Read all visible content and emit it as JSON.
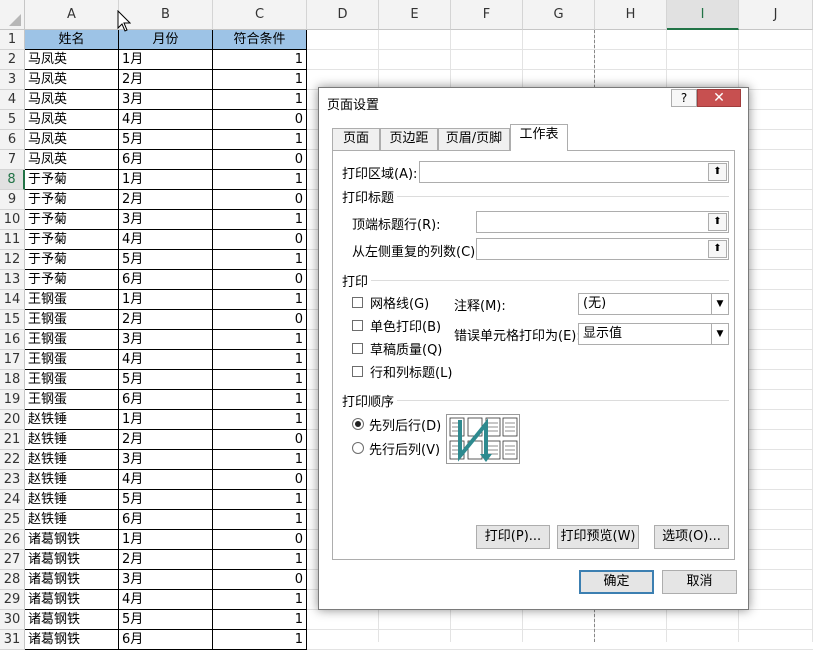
{
  "sheet": {
    "columns": [
      "A",
      "B",
      "C",
      "D",
      "E",
      "F",
      "G",
      "H",
      "I",
      "J"
    ],
    "selected_column": "I",
    "selected_row": 8,
    "rows": [
      1,
      2,
      3,
      4,
      5,
      6,
      7,
      8,
      9,
      10,
      11,
      12,
      13,
      14,
      15,
      16,
      17,
      18,
      19,
      20,
      21,
      22,
      23,
      24,
      25,
      26,
      27,
      28,
      29,
      30,
      31
    ],
    "headers": [
      "姓名",
      "月份",
      "符合条件"
    ],
    "data": [
      [
        "马凤英",
        "1月",
        "1"
      ],
      [
        "马凤英",
        "2月",
        "1"
      ],
      [
        "马凤英",
        "3月",
        "1"
      ],
      [
        "马凤英",
        "4月",
        "0"
      ],
      [
        "马凤英",
        "5月",
        "1"
      ],
      [
        "马凤英",
        "6月",
        "0"
      ],
      [
        "于予菊",
        "1月",
        "1"
      ],
      [
        "于予菊",
        "2月",
        "0"
      ],
      [
        "于予菊",
        "3月",
        "1"
      ],
      [
        "于予菊",
        "4月",
        "0"
      ],
      [
        "于予菊",
        "5月",
        "1"
      ],
      [
        "于予菊",
        "6月",
        "0"
      ],
      [
        "王钢蛋",
        "1月",
        "1"
      ],
      [
        "王钢蛋",
        "2月",
        "0"
      ],
      [
        "王钢蛋",
        "3月",
        "1"
      ],
      [
        "王钢蛋",
        "4月",
        "1"
      ],
      [
        "王钢蛋",
        "5月",
        "1"
      ],
      [
        "王钢蛋",
        "6月",
        "1"
      ],
      [
        "赵铁锤",
        "1月",
        "1"
      ],
      [
        "赵铁锤",
        "2月",
        "0"
      ],
      [
        "赵铁锤",
        "3月",
        "1"
      ],
      [
        "赵铁锤",
        "4月",
        "0"
      ],
      [
        "赵铁锤",
        "5月",
        "1"
      ],
      [
        "赵铁锤",
        "6月",
        "1"
      ],
      [
        "诸葛钢铁",
        "1月",
        "0"
      ],
      [
        "诸葛钢铁",
        "2月",
        "1"
      ],
      [
        "诸葛钢铁",
        "3月",
        "0"
      ],
      [
        "诸葛钢铁",
        "4月",
        "1"
      ],
      [
        "诸葛钢铁",
        "5月",
        "1"
      ],
      [
        "诸葛钢铁",
        "6月",
        "1"
      ]
    ]
  },
  "dialog": {
    "title": "页面设置",
    "help": "?",
    "close": "✕",
    "tabs": [
      "页面",
      "页边距",
      "页眉/页脚",
      "工作表"
    ],
    "active_tab": "工作表",
    "print_area_label": "打印区域(A):",
    "print_titles_group": "打印标题",
    "rows_repeat_label": "顶端标题行(R):",
    "cols_repeat_label": "从左侧重复的列数(C):",
    "print_group": "打印",
    "checkboxes": [
      "网格线(G)",
      "单色打印(B)",
      "草稿质量(Q)",
      "行和列标题(L)"
    ],
    "comments_label": "注释(M):",
    "comments_value": "(无)",
    "errors_label": "错误单元格打印为(E):",
    "errors_value": "显示值",
    "order_group": "打印顺序",
    "order_options": [
      "先列后行(D)",
      "先行后列(V)"
    ],
    "selected_order": 0,
    "print_button": "打印(P)...",
    "preview_button": "打印预览(W)",
    "options_button": "选项(O)...",
    "ok_button": "确定",
    "cancel_button": "取消",
    "ref_icon": "collapse-dialog-icon"
  },
  "colors": {
    "header_fill": "#9dc3e6",
    "selection": "#217346",
    "close_red": "#c75050"
  }
}
